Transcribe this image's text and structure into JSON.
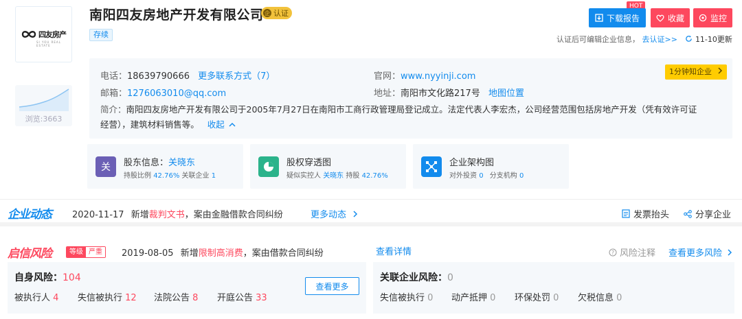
{
  "company": {
    "name": "南阳四友房地产开发有限公司",
    "cert_badge": "认证",
    "status": "存续",
    "logo_text": "四友房产",
    "logo_sub": "SI YOU REAL ESTATE",
    "views_label": "浏览:3663"
  },
  "actions": {
    "report": "下载报告",
    "hot": "HOT",
    "favorite": "收藏",
    "monitor": "监控",
    "cert_hint": "认证后可编辑企业信息，",
    "cert_link": "去认证>>",
    "updated": "11-10更新"
  },
  "info": {
    "phone_label": "电话：",
    "phone": "18639790666",
    "more_contact": "更多联系方式（7）",
    "website_label": "官网：",
    "website": "www.nyyinji.com",
    "email_label": "邮箱：",
    "email": "1276063010@qq.com",
    "address_label": "地址：",
    "address": "南阳市文化路217号",
    "map_link": "地图位置",
    "intro_label": "简介：",
    "intro_line1": "南阳四友房地产开发有限公司于2005年7月27日在南阳市工商行政管理局登记成立。法定代表人李宏杰，公司经营范围包括房地产开发（凭有效许可证",
    "intro_line2": "经营），建筑材料销售等。",
    "collapse": "收起",
    "minute_badge": "1分钟知企业"
  },
  "cards": {
    "shareholder": {
      "icon_char": "关",
      "title_label": "股东信息：",
      "title_value": "关晓东",
      "sub_label1": "持股比例",
      "sub_value1": "42.76%",
      "sub_label2": "关联企业",
      "sub_value2": "1"
    },
    "equity": {
      "title": "股权穿透图",
      "sub_label1": "疑似实控人",
      "sub_value1": "关晓东",
      "sub_label2": "持股",
      "sub_value2": "42.76%"
    },
    "structure": {
      "title": "企业架构图",
      "sub_label1": "对外投资",
      "sub_value1": "0",
      "sub_label2": "分支机构",
      "sub_value2": "0"
    }
  },
  "dynamics": {
    "brand": "企业动态",
    "date": "2020-11-17",
    "prefix": "新增",
    "tag": "裁判文书",
    "text": "，案由金融借款合同纠纷",
    "more": "更多动态",
    "invoice": "发票抬头",
    "share": "分享企业"
  },
  "risk": {
    "brand": "启信风险",
    "level_label": "等级",
    "level_value": "严重",
    "date": "2019-08-05",
    "prefix": "新增",
    "tag": "限制高消费",
    "text": "，案由借款合同纠纷",
    "detail": "查看详情",
    "note": "风险注释",
    "more_risk": "查看更多风险",
    "self_title": "自身风险：",
    "self_total": "104",
    "self_items": [
      {
        "label": "被执行人",
        "value": "4"
      },
      {
        "label": "失信被执行",
        "value": "12"
      },
      {
        "label": "法院公告",
        "value": "8"
      },
      {
        "label": "开庭公告",
        "value": "33"
      }
    ],
    "see_more": "查看更多",
    "related_title": "关联企业风险：",
    "related_total": "0",
    "related_items": [
      {
        "label": "失信被执行",
        "value": "0"
      },
      {
        "label": "动产抵押",
        "value": "0"
      },
      {
        "label": "环保处罚",
        "value": "0"
      },
      {
        "label": "欠税信息",
        "value": "0"
      }
    ]
  },
  "colors": {
    "brand_blue": "#128bed",
    "risk_red": "#fd485e",
    "cert_gold": "#f2c23b",
    "minute_yellow": "#ffcc00",
    "shareholder_icon": "#6b5fb5",
    "equity_icon": "#2bb38b",
    "structure_icon": "#128bed"
  },
  "icons": {
    "report": "download-icon",
    "favorite": "heart-icon",
    "monitor": "eye-icon",
    "refresh": "refresh-icon",
    "collapse": "chevron-up-icon",
    "minute": "chevron-right-icon",
    "equity": "pie-chart-icon",
    "structure": "org-structure-icon",
    "invoice": "invoice-icon",
    "share": "share-icon",
    "note": "help-circle-icon"
  }
}
